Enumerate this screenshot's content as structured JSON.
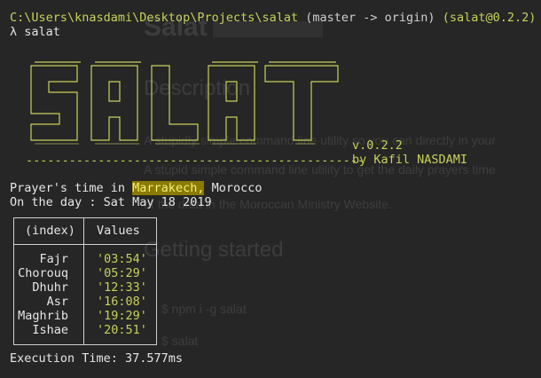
{
  "terminal": {
    "prompt_path": "C:\\Users\\knasdami\\Desktop\\Projects\\salat",
    "prompt_git": "(master -> origin)",
    "prompt_pkg": "(salat@0.2.2)",
    "command_line": "λ salat",
    "logo_text": "SALAT",
    "version": "v.0.2.2",
    "author": "by Kafil NASDAMI",
    "city_prefix": "Prayer's time in ",
    "city": "Marrakech,",
    "country": " Morocco",
    "day_line": "On the day : Sat May 18 2019",
    "execution_time": "Execution Time: 37.577ms"
  },
  "table": {
    "headers": [
      "(index)",
      "Values"
    ],
    "rows": [
      {
        "name": "Fajr",
        "value": "'03:54'"
      },
      {
        "name": "Chorouq",
        "value": "'05:29'"
      },
      {
        "name": "Dhuhr",
        "value": "'12:33'"
      },
      {
        "name": "Asr",
        "value": "'16:08'"
      },
      {
        "name": "Maghrib",
        "value": "'19:29'"
      },
      {
        "name": "Ishae",
        "value": "'20:51'"
      }
    ]
  },
  "background_doc": {
    "title": "Salat",
    "heading_description": "Description",
    "text_1": "A stupidly simple command line utility so you can directly in your",
    "text_2": "A stupid simple command line utility to get the daily prayers time",
    "text_3": "of the data in the Moroccan Ministry Website.",
    "heading_started": "Getting started",
    "code_1": "$ npm i -g salat",
    "code_2": "$ salat"
  },
  "colors": {
    "background": "#262626",
    "accent_yellow": "#c8d15a",
    "highlight": "#8a7a00"
  }
}
